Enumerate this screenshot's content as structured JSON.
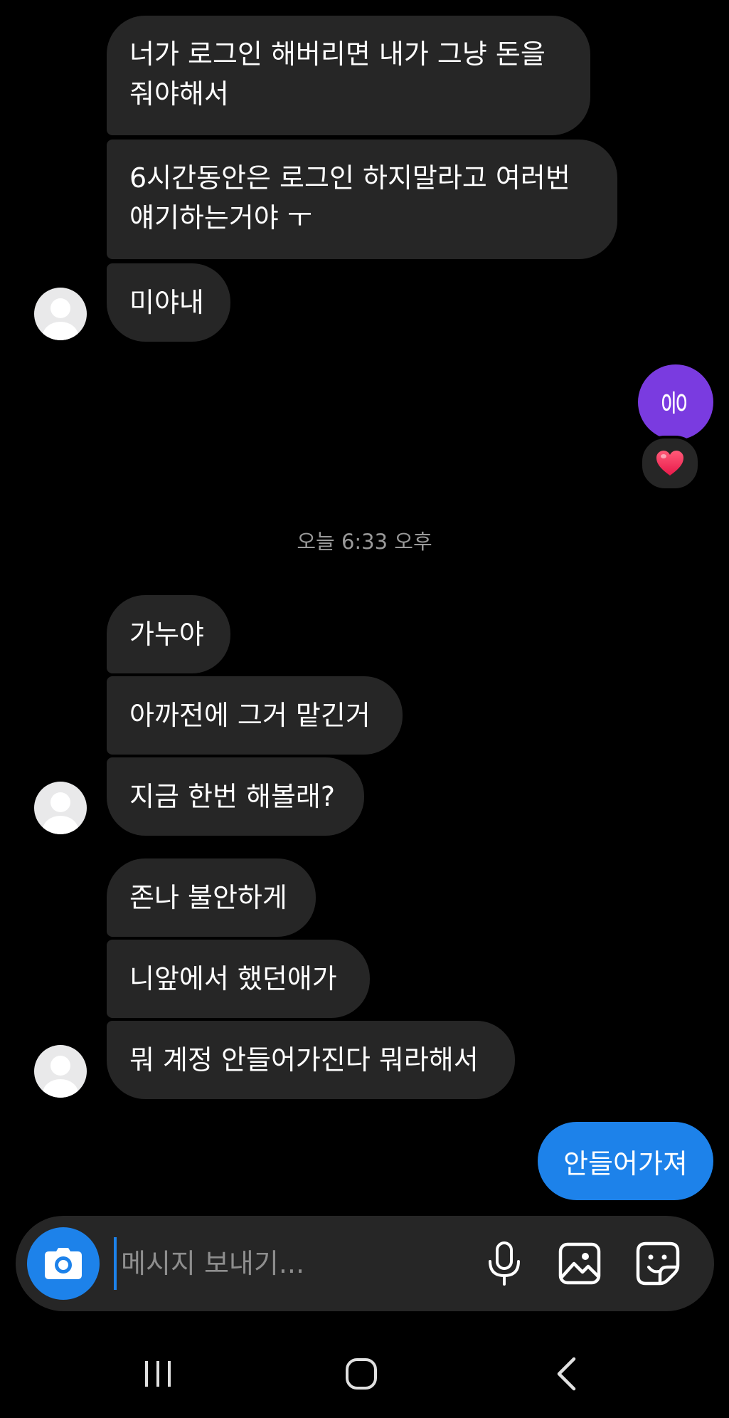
{
  "messages_top": {
    "msg1": "너가 로그인 해버리면 내가 그냥 돈을\n줘야해서",
    "msg2": "6시간동안은 로그인 하지말라고 여러번\n얘기하는거야 ㅜ",
    "msg3": "미야내"
  },
  "my_reply_circle": "응",
  "reaction_emoji": "❤️",
  "timestamp": "오늘 6:33 오후",
  "messages_group2": {
    "msg1": "가누야",
    "msg2": "아까전에 그거 맡긴거",
    "msg3": "지금 한번 해볼래?"
  },
  "messages_group3": {
    "msg1": "존나 불안하게",
    "msg2": "니앞에서 했던애가",
    "msg3": "뭐 계정 안들어가진다 뭐라해서"
  },
  "sent_message": "안들어가져",
  "composer": {
    "placeholder": "메시지 보내기...",
    "value": ""
  },
  "colors": {
    "background": "#000000",
    "received_bubble": "#262626",
    "sent_bubble": "#1d82ea",
    "purple_bubble": "#7a3be0",
    "timestamp_text": "#9a9a9a"
  },
  "icons": {
    "camera": "camera-icon",
    "microphone": "microphone-icon",
    "gallery": "gallery-icon",
    "sticker": "sticker-icon",
    "nav_recents": "recents-icon",
    "nav_home": "home-icon",
    "nav_back": "back-icon"
  }
}
